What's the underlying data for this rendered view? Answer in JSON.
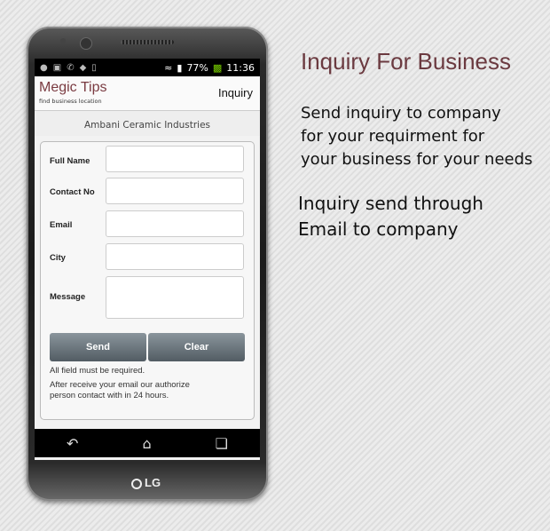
{
  "promo": {
    "title": "Inquiry For Business",
    "line1": "Send inquiry to company",
    "line2": "for your requirment for",
    "line3": "your business for your needs",
    "line4": "Inquiry send through",
    "line5": "Email to company"
  },
  "statusbar": {
    "battery": "77%",
    "time": "11:36"
  },
  "appbar": {
    "logo": "Megic Tips",
    "logo_sub": "find business location",
    "title": "Inquiry"
  },
  "company": "Ambani  Ceramic Industries",
  "form": {
    "full_name_label": "Full Name",
    "contact_label": "Contact No",
    "email_label": "Email",
    "city_label": "City",
    "message_label": "Message",
    "send_label": "Send",
    "clear_label": "Clear",
    "note1": "All field must be required.",
    "note2": "After receive your email our authorize",
    "note3": "person contact with in 24 hours."
  },
  "device": {
    "brand": "LG"
  },
  "icons": [
    "lock-icon",
    "image-icon",
    "whatsapp-icon",
    "shield-icon",
    "phone-icon",
    "back-icon",
    "home-icon",
    "recent-apps-icon",
    "wifi-icon",
    "signal-icon",
    "battery-icon"
  ]
}
